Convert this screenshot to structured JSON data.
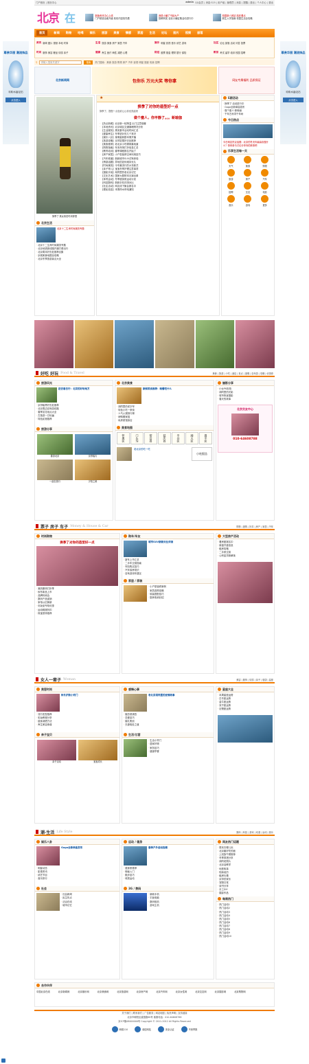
{
  "topbar": {
    "left": "门户首页 | 首页中心",
    "user": "admin",
    "links": "QQ会员 | 消息:525 | 用户组 | 管理员 | 消息 | 提醒 | 退出 | 个人中心 | 退出"
  },
  "header": {
    "logo_a": "北京",
    "logo_b": "在线",
    "promo": [
      {
        "title": "新版资讯中心上线",
        "sub": "门户频道全面升级 精彩内容抢先看"
      },
      {
        "title": "我是小编了不起大户",
        "sub": "投稿有奖 全民小编征集活动进行中"
      },
      {
        "title": "校园新人网站 精彩看点",
        "sub": "新生入学指南 校园生活全攻略"
      }
    ]
  },
  "nav": {
    "items": [
      "首页",
      "新闻",
      "购物",
      "吃喝",
      "娱乐",
      "旅游",
      "美食",
      "情感",
      "家居",
      "生活",
      "论坛",
      "图片",
      "视频",
      "部落"
    ]
  },
  "subnav": [
    {
      "cat": "资讯",
      "items": "新闻 图片 视频 本地 时事"
    },
    {
      "cat": "生活",
      "items": "旅游 美食 房产 家居 汽车"
    },
    {
      "cat": "娱乐",
      "items": "明星 影视 音乐 综艺 游戏"
    },
    {
      "cat": "社区",
      "items": "论坛 部落 活动 问答 投票"
    },
    {
      "cat": "时尚",
      "items": "服饰 美容 奢品 情感 亲子"
    },
    {
      "cat": "健康",
      "items": "养生 医疗 两性 减肥 心理"
    },
    {
      "cat": "财经",
      "items": "股票 基金 理财 银行 保险"
    },
    {
      "cat": "教育",
      "items": "考试 留学 培训 校园 招聘"
    }
  ],
  "search": {
    "placeholder": "请输入搜索关键字",
    "button": "搜索",
    "hot": "热门搜索：美食 旅游 购物 房产 汽车 影视 明星 摄影 相亲 招聘"
  },
  "sidead": {
    "title": "尊贵华丽 潮流饰品",
    "brand": "珍珠/水晶/钻石",
    "btn": "点击进入"
  },
  "banner": {
    "left": "北京新闻网",
    "mid": "包你乐 万元大奖 等你拿",
    "right": "网友专属福利 品质保证"
  },
  "focus": {
    "caption": "换季了 美女街拍时尚穿搭",
    "title": "北京生活",
    "items": [
      "北京十二生肖时尚潮流专题",
      "北京地铁新线路开通方便出行",
      "北京周末好去处推荐合集",
      "京城美食地图全攻略",
      "北京冬季旅游景点大全"
    ]
  },
  "headline": {
    "title": "换季了对你的造型好一点",
    "sub1": "换季了，搭配一点色彩让心情也亮起来",
    "title2": "做个瘦人，你平静了。。。新瑜伽",
    "lists": [
      "【热点新闻】北京新一轮降温 出门注意保暖",
      "【本地资讯】北京城区交通拥堵情况分析",
      "【生活服务】周末集市活动时间汇总",
      "【健康养生】冬季进补的几个常识",
      "【娱乐八卦】某明星新剧本周开播",
      "【旅游攻略】京郊赏雪好去处推荐",
      "【美食推荐】老北京小吃哪家最地道",
      "【购物指南】年末商场打折信息汇总",
      "【教育培训】春季课程报名开始了",
      "【房产家居】小户型装修空间利用技巧",
      "【汽车频道】新款城市SUV试驾体验",
      "【情感话题】异地恋如何维持长久",
      "【时尚潮流】今冬最流行的大衣款式",
      "【亲子育儿】宝宝冬季护理注意事项",
      "【摄影天地】胡同里的老北京记忆",
      "【文化艺术】国家大剧院本月演出单",
      "【体育运动】冬季健身房运动计划",
      "【科技数码】新款手机评测对比",
      "【社区活动】网友线下聚会报名中",
      "【便民信息】本周停水停电通知"
    ]
  },
  "right": {
    "act_title": "E期活动",
    "act": [
      "换季了·活动进行中",
      "Gaga全新单曲发布",
      "做个瘦人·新瑜伽",
      "千年古刹寻千年树"
    ],
    "today_title": "今日热点",
    "today": "今日网友热议话题：北京的冬天你最喜欢做什么？快来参与讨论分享你的故事吧",
    "fun_title": "乐享生活每一天",
    "fun": [
      "天气",
      "美食",
      "购物",
      "旅游",
      "房产",
      "汽车",
      "招聘",
      "交友",
      "电影",
      "音乐",
      "游戏",
      "更多"
    ]
  },
  "section1": {
    "title": "好吃 好玩",
    "en": "Food & Travel",
    "links": "美食 | 旅游 | 小吃 | 酒店 | 景点 | 度假 | 自驾游 | 攻略 | 优惠券"
  },
  "food": {
    "h": "旅游风光",
    "title": "赶去春日行：北京的好玩地方",
    "list": [
      "京郊踏青好去处推荐",
      "北京周边自驾游线路",
      "春季赏花地点大全",
      "古镇游一日玩遍",
      "特色民宿推荐"
    ],
    "share_h": "旅游分享",
    "share": [
      "春游北京",
      "京郊踏青",
      "一起去旅行",
      "夕阳之美"
    ]
  },
  "food2": {
    "h": "北京美食",
    "title": "新鲜美食推荐：晚餐吃什么",
    "list": [
      "胡同里的老字号",
      "特色小吃一条街",
      "人气火锅排行榜",
      "烤鸭哪家强",
      "私房菜馆探店"
    ],
    "h2": "美食地图",
    "cal": [
      "怀柔区",
      "门头沟",
      "密云县",
      "延庆县",
      "平谷区",
      "顺义区",
      "昌平区"
    ],
    "sub": "老北京的吃一吃",
    "sub2": "小吃报告"
  },
  "food3": {
    "h": "摄影分享",
    "list": [
      "小伙PK街拍",
      "胡同里的光影",
      "城市夜景摄影",
      "春天的故事"
    ],
    "ad_title": "北京交友中心",
    "ad_phone": "010-64608788"
  },
  "section2": {
    "title": "票子 房子 车子",
    "en": "Money & House & Car",
    "links": "购物 | 团购 | 折扣 | 房产 | 家居 | 汽车"
  },
  "money": {
    "h": "时尚购物",
    "title": "换季了对你的造型好一点",
    "list": [
      "潮流服饰打折季",
      "秋冬新品上市",
      "品牌特卖会",
      "数码产品促销",
      "家电以旧换新",
      "化妆品专柜优惠",
      "运动鞋服折扣",
      "珠宝首饰推荐"
    ]
  },
  "house": {
    "h": "购车/车友",
    "title": "城市SUV新款对比评测",
    "list": [
      "新车上市汇总",
      "二手车交易指南",
      "车险购买技巧",
      "汽车保养常识",
      "自驾游用车建议"
    ],
    "h2": "家居 / 家装",
    "list2": [
      "小户型装修案例",
      "家具选购攻略",
      "软装搭配技巧",
      "厨房收纳妙招"
    ]
  },
  "car": {
    "h": "大型房产活动",
    "list": [
      "看房团报名中",
      "新盘开盘信息",
      "租房攻略",
      "二手房交易",
      "公积金贷款解读"
    ]
  },
  "section3": {
    "title": "女人一辈子",
    "en": "Woman",
    "links": "美容 | 服饰 | 情感 | 亲子 | 健康 | 星座"
  },
  "woman": {
    "h": "美容时尚",
    "title": "秋冬护肤小窍门",
    "list": [
      "流行发型推荐",
      "彩妆教程分享",
      "瘦身减肥方法",
      "养生美容食谱"
    ],
    "h2": "亲子宝贝",
    "cap": [
      "亲子活动",
      "宝宝成长"
    ]
  },
  "woman2": {
    "h": "感情心事",
    "title": "老北京胡同里的爱情故事",
    "list": [
      "婚恋观调查",
      "恋爱技巧",
      "婚礼策划",
      "夫妻相处之道"
    ],
    "h2": "生活/亿客",
    "list2": [
      "生活小窍门",
      "居家好物",
      "家务技巧",
      "健康早餐"
    ]
  },
  "woman3": {
    "h": "星座大全",
    "list": [
      "本周星座运势",
      "白羊座运势",
      "金牛座运势",
      "双子座运势",
      "巨蟹座运势"
    ]
  },
  "section4": {
    "title": "潮·生活",
    "en": "Life Style",
    "links": "数码 | 科技 | 游戏 | 动漫 | 运动 | 音乐"
  },
  "life": {
    "h": "娱乐八卦",
    "title": "Gaga全新单曲发布",
    "list": [
      "明星动态",
      "影视资讯",
      "综艺节目",
      "音乐排行"
    ],
    "h2": "社会",
    "list2": [
      "社会新闻",
      "民生热点",
      "法治在线",
      "城市记忆"
    ]
  },
  "life2": {
    "h": "运动 / 健身",
    "title": "春季户外运动指南",
    "list": [
      "健身房推荐",
      "瑜伽入门",
      "跑步技巧",
      "球类运动"
    ],
    "h2": "3G / 数码",
    "list2": [
      "新款手机",
      "平板电脑",
      "数码相机",
      "游戏主机"
    ]
  },
  "life3": {
    "h": "网友热门话题",
    "list": [
      "周末去哪儿玩",
      "北京最好吃的面",
      "上班族午餐推荐",
      "冬季穿搭分享",
      "胡同老照片",
      "北京话教学",
      "地铁故事",
      "相亲经历",
      "租房吐槽",
      "京郊农家乐",
      "宠物日常",
      "读书分享",
      "手工DIY",
      "摄影作品"
    ],
    "h2": "每周热门",
    "list2": [
      "热门活动1",
      "热门活动2",
      "热门活动3",
      "热门活动4",
      "热门活动5",
      "热门活动6",
      "热门活动7",
      "热门活动8",
      "热门活动9",
      "热门活动10"
    ]
  },
  "friends": {
    "title": "合作伙伴",
    "links": [
      "中国北京在线",
      "北京新闻网",
      "北京娱乐网",
      "北京美食网",
      "北京旅游网",
      "北京房产网",
      "北京汽车网",
      "北京女性网",
      "北京交友网",
      "北京摄影网",
      "北京购物网"
    ]
  },
  "footer": {
    "l1": "关于我们 | 联系我们 | 广告服务 | 网站地图 | 免责声明 | 友情链接",
    "l2": "北京市朝阳区建国路88号 客服电话：010-64608788",
    "l3": "京ICP备08000000号 Copyright © 2011-2012 All Rights Reserved",
    "badges": [
      "网络110",
      "诚信网站",
      "安全认证",
      "不良举报"
    ]
  }
}
